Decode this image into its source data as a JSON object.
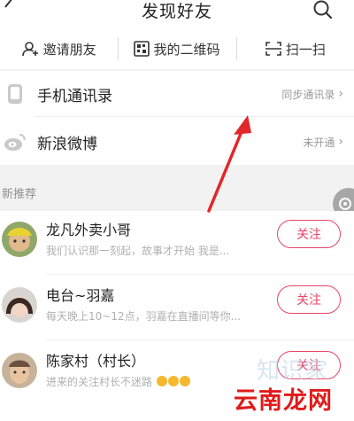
{
  "header": {
    "title": "发现好友"
  },
  "actions": [
    {
      "label": "邀请朋友",
      "icon": "add-user-icon"
    },
    {
      "label": "我的二维码",
      "icon": "qr-code-icon"
    },
    {
      "label": "扫一扫",
      "icon": "scan-icon"
    }
  ],
  "rows": {
    "contacts": {
      "label": "手机通讯录",
      "right": "同步通讯录",
      "icon": "phone-icon"
    },
    "weibo": {
      "label": "新浪微博",
      "right": "未开通",
      "icon": "weibo-icon"
    }
  },
  "section": {
    "label": "新推荐"
  },
  "users": [
    {
      "name": "龙凡外卖小哥",
      "desc": "我们认识那一刻起，故事才开始   我是...",
      "follow": "关注"
    },
    {
      "name": "电台~羽嘉",
      "desc": "每天晚上10~12点，羽嘉在直播间等你...",
      "follow": "关注"
    },
    {
      "name": "陈家村（村长）",
      "desc": "进来的关注村长不迷路",
      "follow": "关注"
    }
  ],
  "watermark": {
    "line1": "知识家",
    "line2": "云南龙网"
  },
  "colors": {
    "accent": "#e94566",
    "arrow": "#e0282c"
  }
}
